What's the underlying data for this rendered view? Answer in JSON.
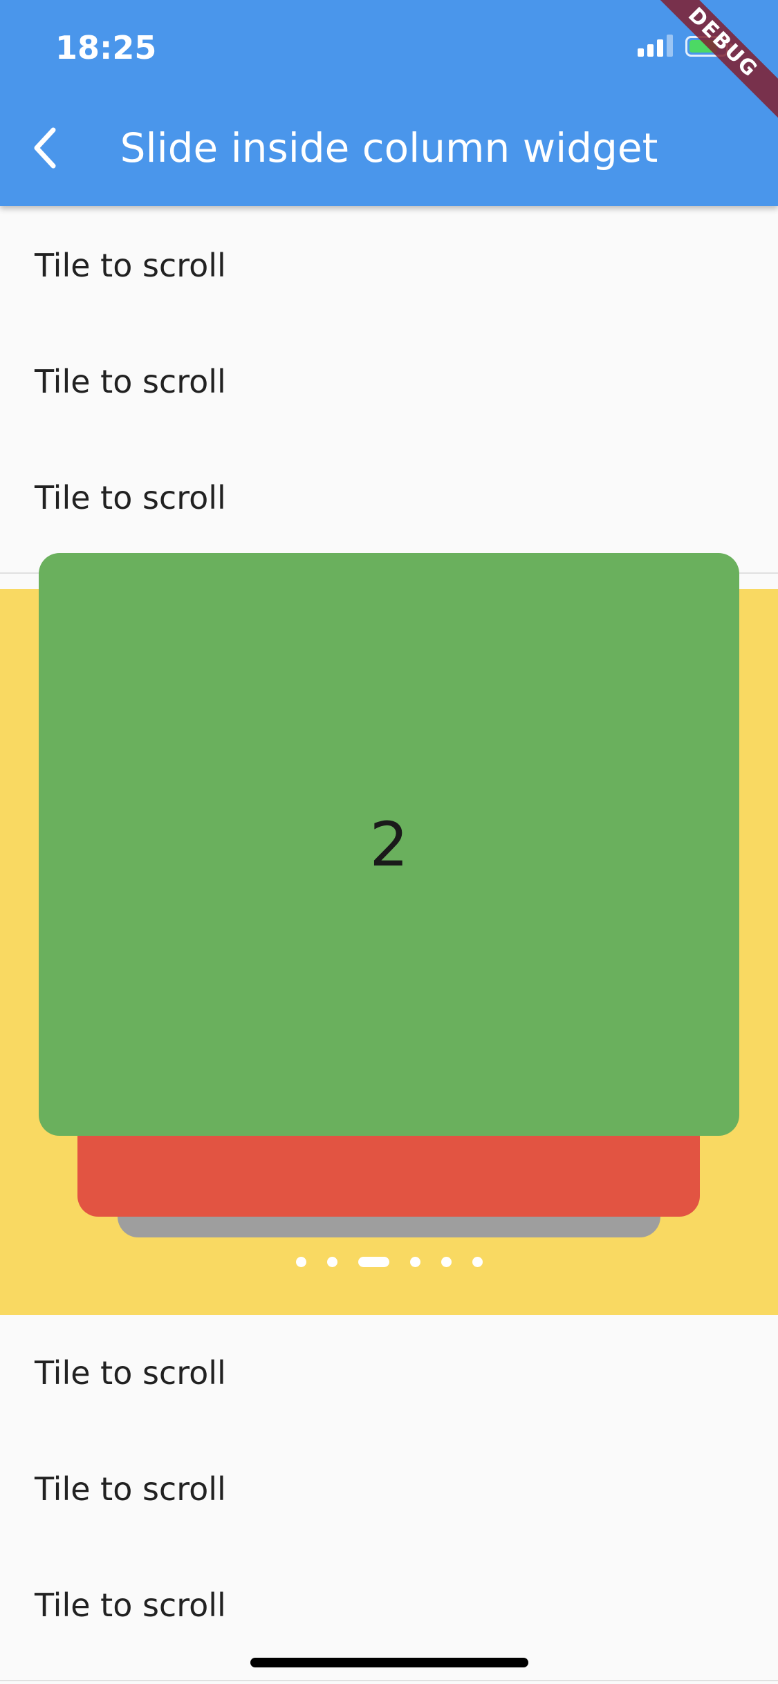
{
  "status_bar": {
    "time": "18:25",
    "signal_icon": "signal-icon",
    "battery_icon": "battery-charging-icon"
  },
  "debug_banner": {
    "label": "DEBUG"
  },
  "app_bar": {
    "back_icon": "chevron-left-icon",
    "title": "Slide inside column widget",
    "color": "#4a96eb"
  },
  "tiles_top": [
    {
      "label": "Tile to scroll"
    },
    {
      "label": "Tile to scroll"
    },
    {
      "label": "Tile to scroll"
    }
  ],
  "slider": {
    "background_color": "#f9d962",
    "current_card": {
      "label": "2",
      "color": "#6ab05d"
    },
    "stacked_cards": [
      {
        "color": "#e25442"
      },
      {
        "color": "#9e9e9e"
      }
    ],
    "page_count": 6,
    "active_page_index": 2
  },
  "tiles_bottom": [
    {
      "label": "Tile to scroll"
    },
    {
      "label": "Tile to scroll"
    },
    {
      "label": "Tile to scroll"
    }
  ]
}
